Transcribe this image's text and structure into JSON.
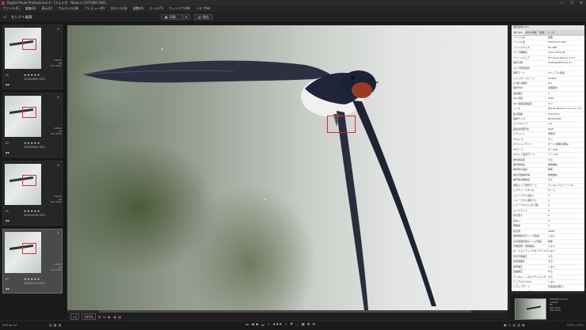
{
  "window": {
    "title": "Digital Photo Professional 4 - [フォルダ - Nikon-L:FOTO4K1306]",
    "controls": [
      "—",
      "☐",
      "✕"
    ]
  },
  "menu": [
    "ファイル(F)",
    "編集(E)",
    "表示(V)",
    "サムネイル(N)",
    "プレビュー(P)",
    "スタイル(S)",
    "調整(A)",
    "ツール(T)",
    "ウィンドウ(W)",
    "ヘルプ(H)"
  ],
  "toolbar": {
    "back_icon": "back-arrow-icon",
    "view_title": "セレクト編集",
    "print_label": "印刷",
    "save_label": "保存"
  },
  "thumbnails": [
    {
      "file": "5G5A0005.CR3",
      "stars": "★★★★★",
      "meta": [
        "1/1600",
        "F8",
        "ISO 2000"
      ],
      "selected": false
    },
    {
      "file": "5G5A0004.CR3",
      "stars": "★★★★★",
      "meta": [
        "1/1600",
        "F8",
        "ISO 2000"
      ],
      "selected": false
    },
    {
      "file": "5G5A0476.CR3",
      "stars": "★★★★★",
      "meta": [
        "1/1600",
        "F8",
        "ISO 2000"
      ],
      "selected": false
    },
    {
      "file": "5G5A0474.CR3",
      "stars": "★★★★★",
      "meta": [
        "1/1600",
        "F8",
        "ISO 2000"
      ],
      "selected": true
    }
  ],
  "infopanel": {
    "header": "撮影情報(Info)",
    "tabs": [
      "撮影情報",
      "IPTC 情報",
      "情報",
      "レンズ"
    ],
    "rows": [
      [
        "ファイル名",
        "画像"
      ],
      [
        "ファイル名",
        "5G5A0474.CR3"
      ],
      [
        "ファイルサイズ",
        "26.7MB"
      ],
      [
        "カメラ機種名",
        "Canon EOS R5"
      ],
      [
        "ファームウェア",
        "Firmware Version 1.8.1"
      ],
      [
        "撮影日時",
        "2022/06/28 8:00:47"
      ],
      [
        "カメラ所有者名",
        ""
      ],
      [
        "撮影モード",
        "マニュアル露出"
      ],
      [
        "シャッタースピード",
        "1/1600"
      ],
      [
        "Av(絞り数値)",
        "8.0"
      ],
      [
        "測光方式",
        "評価測光"
      ],
      [
        "露出補正",
        "0"
      ],
      [
        "ISO 感度",
        "2000"
      ],
      [
        "ISO 感度拡張設定",
        "オフ"
      ],
      [
        "レンズ",
        "RF100-500mm F4.5-7.1 L IS"
      ],
      [
        "焦点距離",
        "500.0mm"
      ],
      [
        "画像サイズ",
        "8192x5464"
      ],
      [
        "ロスクロップ",
        "1.6"
      ],
      [
        "画質(記録形式)",
        "RAW"
      ],
      [
        "フラッシュ",
        "非発光"
      ],
      [
        "FEロック",
        "オフ"
      ],
      [
        "ホワイトバランス",
        "オート(雰囲気優先)"
      ],
      [
        "AFモード",
        "サーボAF"
      ],
      [
        "AFエリア設定モード",
        "ゾーンAF"
      ],
      [
        "被写体追尾",
        "する"
      ],
      [
        "被写体検出",
        "動物優先"
      ],
      [
        "撮影時の画質",
        "標準"
      ],
      [
        "検出可能被写体",
        "動物優先"
      ],
      [
        "被写体の瞳検出",
        "する"
      ],
      [
        "測距エリア選択モード",
        "フレキシブルゾーン AF"
      ],
      [
        "ピクチャースタイル",
        "オート"
      ],
      [
        "シャープネス(強さ)",
        "4"
      ],
      [
        "シャープネス(細かさ)",
        "2"
      ],
      [
        "シャープネス(しきい値)",
        "4"
      ],
      [
        "コントラスト",
        "0"
      ],
      [
        "色の濃さ",
        "0"
      ],
      [
        "色あい",
        "0"
      ],
      [
        "明瞭度",
        "0"
      ],
      [
        "色空間",
        "sRGB"
      ],
      [
        "長秒時露光のノイズ低減",
        "しない"
      ],
      [
        "高感度撮影時のノイズ低減",
        "標準"
      ],
      [
        "高輝度側・階調優先",
        "しない"
      ],
      [
        "オートライティングオプティマイザ",
        "しない"
      ],
      [
        "周辺光量補正",
        "する"
      ],
      [
        "色収差補正",
        "する"
      ],
      [
        "回折補正",
        "しない"
      ],
      [
        "歪曲補正",
        "する"
      ],
      [
        "デジタルレンズオプティマイザ",
        "する"
      ],
      [
        "デュアルピクセル",
        "しない"
      ],
      [
        "ドライブモード",
        "高速連続撮影＋"
      ],
      [
        "ライブビュー撮影",
        "オン"
      ],
      [
        "カメラBody No.",
        "061023000383"
      ],
      [
        "コメント",
        ""
      ]
    ]
  },
  "viewbar": {
    "fit_label": "▫1",
    "zoom_label": "100%",
    "icons": [
      "grid-icon",
      "af-point-icon",
      "highlight-icon",
      "shadow-icon",
      "layout-icon"
    ]
  },
  "navigator": {
    "meta": [
      "5G5A0474.CR3",
      "1/1600",
      "F8",
      "ISO 2000",
      "500.0mm"
    ]
  },
  "statusbar": {
    "left": "RAW ▪ 1/4",
    "center_icons": [
      "⏮",
      "◀",
      "▶",
      "⏭",
      "☆",
      "★★★",
      "✓",
      "⚑",
      "⬚",
      "▣",
      "⊞",
      "⊟"
    ],
    "right": "4128 / 4332",
    "panel_icons": [
      "▣",
      "▢",
      "▤",
      "▥",
      "▦"
    ],
    "left_icons": [
      "▥",
      "▦",
      "▧"
    ]
  }
}
